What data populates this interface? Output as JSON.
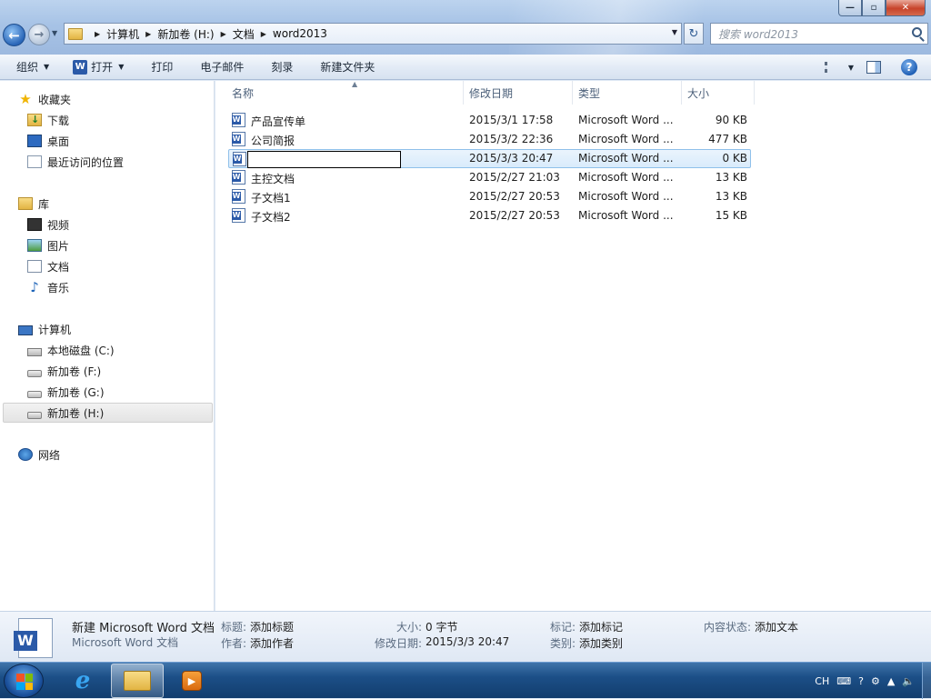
{
  "window": {
    "caption_min": "—",
    "caption_max": "▫",
    "caption_close": "✕"
  },
  "nav": {
    "back_glyph": "←",
    "forward_glyph": "→",
    "breadcrumb": [
      "计算机",
      "新加卷 (H:)",
      "文档",
      "word2013"
    ],
    "search_placeholder": "搜索 word2013"
  },
  "toolbar": {
    "organize": "组织",
    "open": "打开",
    "print": "打印",
    "email": "电子邮件",
    "burn": "刻录",
    "new_folder": "新建文件夹"
  },
  "sidebar": {
    "favorites": {
      "label": "收藏夹",
      "items": [
        "下载",
        "桌面",
        "最近访问的位置"
      ]
    },
    "libraries": {
      "label": "库",
      "items": [
        "视频",
        "图片",
        "文档",
        "音乐"
      ]
    },
    "computer": {
      "label": "计算机",
      "items": [
        "本地磁盘 (C:)",
        "新加卷 (F:)",
        "新加卷 (G:)",
        "新加卷 (H:)"
      ]
    },
    "network": {
      "label": "网络"
    }
  },
  "columns": {
    "name": "名称",
    "modified": "修改日期",
    "type": "类型",
    "size": "大小"
  },
  "files": [
    {
      "name": "产品宣传单",
      "modified": "2015/3/1 17:58",
      "type": "Microsoft Word ...",
      "size": "90 KB"
    },
    {
      "name": "公司简报",
      "modified": "2015/3/2 22:36",
      "type": "Microsoft Word ...",
      "size": "477 KB"
    },
    {
      "name": "",
      "modified": "2015/3/3 20:47",
      "type": "Microsoft Word ...",
      "size": "0 KB"
    },
    {
      "name": "主控文档",
      "modified": "2015/2/27 21:03",
      "type": "Microsoft Word ...",
      "size": "13 KB"
    },
    {
      "name": "子文档1",
      "modified": "2015/2/27 20:53",
      "type": "Microsoft Word ...",
      "size": "13 KB"
    },
    {
      "name": "子文档2",
      "modified": "2015/2/27 20:53",
      "type": "Microsoft Word ...",
      "size": "15 KB"
    }
  ],
  "details": {
    "filename": "新建 Microsoft Word 文档",
    "filetype": "Microsoft Word 文档",
    "title_label": "标题:",
    "title_value": "添加标题",
    "author_label": "作者:",
    "author_value": "添加作者",
    "size_label": "大小:",
    "size_value": "0 字节",
    "modified_label": "修改日期:",
    "modified_value": "2015/3/3 20:47",
    "tags_label": "标记:",
    "tags_value": "添加标记",
    "category_label": "类别:",
    "category_value": "添加类别",
    "status_label": "内容状态:",
    "status_value": "添加文本"
  },
  "taskbar": {
    "ie_glyph": "e",
    "tray_lang": "CH",
    "tray_help": "?"
  },
  "colors": {
    "accent": "#2b5aa8",
    "selection": "#d9ebfb",
    "taskbar": "#1c4f87"
  }
}
